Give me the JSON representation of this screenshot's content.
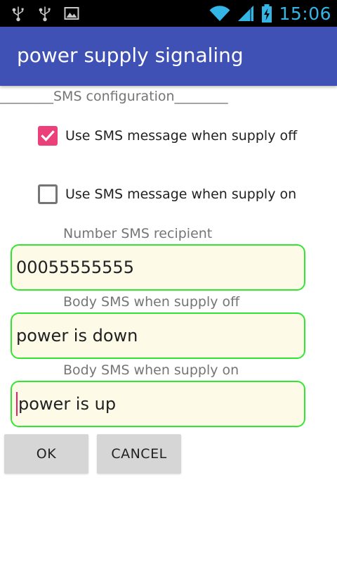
{
  "status_bar": {
    "icons_left": [
      "usb-icon",
      "usb-icon",
      "gallery-icon"
    ],
    "icons_right": [
      "wifi-icon",
      "signal-icon",
      "battery-charging-icon"
    ],
    "time": "15:06"
  },
  "app_bar": {
    "title": "power supply signaling",
    "color": "#3f51b5"
  },
  "form": {
    "section_title": "________SMS configuration________",
    "checkbox_supply_off": {
      "label": "Use SMS message when supply off",
      "checked": true
    },
    "checkbox_supply_on": {
      "label": "Use SMS message when supply on",
      "checked": false
    },
    "recipient": {
      "label": "Number SMS recipient",
      "value": "00055555555"
    },
    "body_off": {
      "label": "Body SMS when supply off",
      "value": "power is down"
    },
    "body_on": {
      "label": "Body SMS when supply on",
      "value": "power is up"
    },
    "ok_label": "OK",
    "cancel_label": "CANCEL"
  },
  "colors": {
    "accent": "#ec407a",
    "field_border": "#33e533",
    "field_background": "#fdfbe8",
    "clock": "#33b5e5"
  }
}
